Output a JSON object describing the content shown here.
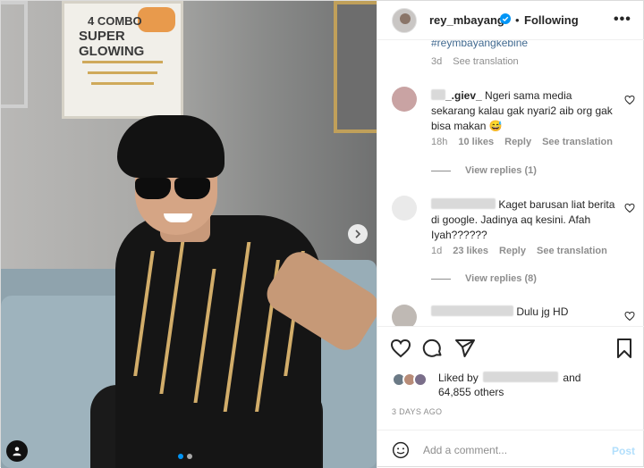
{
  "header": {
    "username": "rey_mbayang",
    "separator": "•",
    "follow_state": "Following",
    "more": "•••"
  },
  "colors": {
    "link": "#00376b",
    "verified": "#0095f6",
    "muted": "#8e8e8e",
    "post_disabled": "#b2dffc"
  },
  "comments": {
    "caption_tail": {
      "hashtag": "#reymbayangkebine",
      "age": "3d",
      "translation": "See translation"
    },
    "items": [
      {
        "author_visible": "_.giev_",
        "text": "Ngeri sama media sekarang kalau gak nyari2 aib org gak bisa makan 😅",
        "age": "18h",
        "likes": "10 likes",
        "reply": "Reply",
        "translation": "See translation",
        "view_replies": "View replies (1)"
      },
      {
        "author_visible": "",
        "text": "Kaget barusan liat berita di google. Jadinya aq kesini. Afah Iyah??????",
        "age": "1d",
        "likes": "23 likes",
        "reply": "Reply",
        "translation": "See translation",
        "view_replies": "View replies (8)"
      },
      {
        "author_visible": "",
        "text": "Dulu jg HD"
      }
    ]
  },
  "likes": {
    "liked_by_prefix": "Liked by",
    "and": "and",
    "others": "64,855 others"
  },
  "date": "3 DAYS AGO",
  "composer": {
    "placeholder": "Add a comment...",
    "post_label": "Post"
  },
  "icons": {
    "heart": "heart-icon",
    "comment": "comment-icon",
    "share": "share-icon",
    "save": "bookmark-icon",
    "emoji": "emoji-icon"
  }
}
